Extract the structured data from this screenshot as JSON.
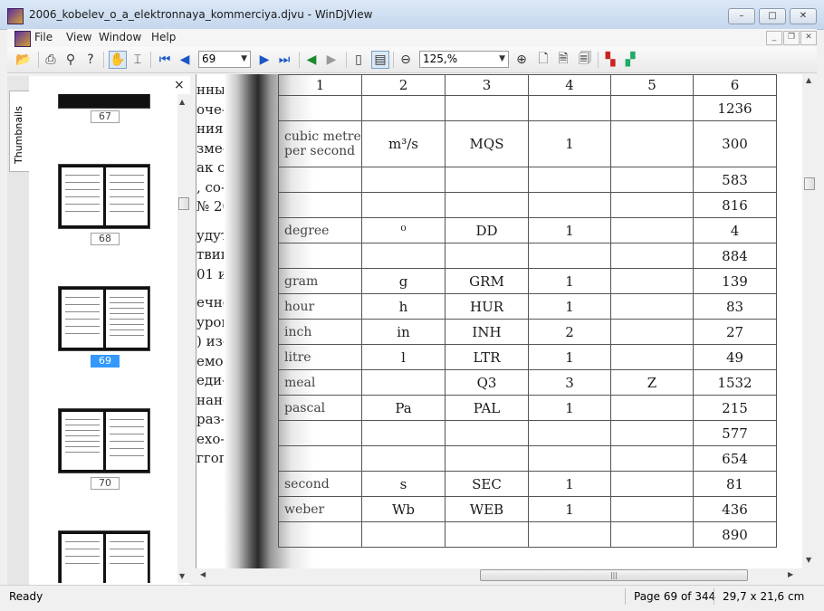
{
  "window": {
    "title": "2006_kobelev_o_a_elektronnaya_kommerciya.djvu - WinDjView"
  },
  "menu": [
    "File",
    "View",
    "Window",
    "Help"
  ],
  "toolbar": {
    "page_value": "69",
    "zoom_value": "125,%"
  },
  "side_panel": {
    "tab_label": "Thumbnails",
    "close_label": "×"
  },
  "thumbnails": [
    {
      "label": "67"
    },
    {
      "label": "68"
    },
    {
      "label": "69",
      "selected": true
    },
    {
      "label": "70"
    }
  ],
  "left_page_fragments": [
    "нные",
    "оче-",
    "ния в",
    "зме-",
    "ак с",
    ", со-",
    "№ 20",
    "удут",
    "твии",
    "01 и",
    "ечне",
    "урой.",
    ") из-",
    "емой",
    "еди-",
    "нан-",
    "раз-",
    "ехо-",
    "ггого"
  ],
  "table": {
    "header": [
      "1",
      "2",
      "3",
      "4",
      "5",
      "6"
    ],
    "rows": [
      {
        "name": "",
        "sym": "",
        "code": "",
        "lvl": "",
        "z": "",
        "num": "1236"
      },
      {
        "name": "cubic metre per second",
        "sym": "m³/s",
        "code": "MQS",
        "lvl": "1",
        "z": "",
        "num": "300"
      },
      {
        "name": "",
        "sym": "",
        "code": "",
        "lvl": "",
        "z": "",
        "num": "583"
      },
      {
        "name": "",
        "sym": "",
        "code": "",
        "lvl": "",
        "z": "",
        "num": "816"
      },
      {
        "name": "degree",
        "sym": "⁰",
        "code": "DD",
        "lvl": "1",
        "z": "",
        "num": "4"
      },
      {
        "name": "",
        "sym": "",
        "code": "",
        "lvl": "",
        "z": "",
        "num": "884"
      },
      {
        "name": "gram",
        "sym": "g",
        "code": "GRM",
        "lvl": "1",
        "z": "",
        "num": "139"
      },
      {
        "name": "hour",
        "sym": "h",
        "code": "HUR",
        "lvl": "1",
        "z": "",
        "num": "83"
      },
      {
        "name": "inch",
        "sym": "in",
        "code": "INH",
        "lvl": "2",
        "z": "",
        "num": "27"
      },
      {
        "name": "litre",
        "sym": "l",
        "code": "LTR",
        "lvl": "1",
        "z": "",
        "num": "49"
      },
      {
        "name": "meal",
        "sym": "",
        "code": "Q3",
        "lvl": "3",
        "z": "Z",
        "num": "1532"
      },
      {
        "name": "pascal",
        "sym": "Pa",
        "code": "PAL",
        "lvl": "1",
        "z": "",
        "num": "215"
      },
      {
        "name": "",
        "sym": "",
        "code": "",
        "lvl": "",
        "z": "",
        "num": "577"
      },
      {
        "name": "",
        "sym": "",
        "code": "",
        "lvl": "",
        "z": "",
        "num": "654"
      },
      {
        "name": "second",
        "sym": "s",
        "code": "SEC",
        "lvl": "1",
        "z": "",
        "num": "81"
      },
      {
        "name": "weber",
        "sym": "Wb",
        "code": "WEB",
        "lvl": "1",
        "z": "",
        "num": "436"
      },
      {
        "name": "",
        "sym": "",
        "code": "",
        "lvl": "",
        "z": "",
        "num": "890"
      }
    ]
  },
  "status": {
    "left": "Ready",
    "page": "Page 69 of 344",
    "size": "29,7 x 21,6 cm"
  },
  "colors": {
    "selection": "#3399ff",
    "titlebar": "#c5d7ee"
  }
}
